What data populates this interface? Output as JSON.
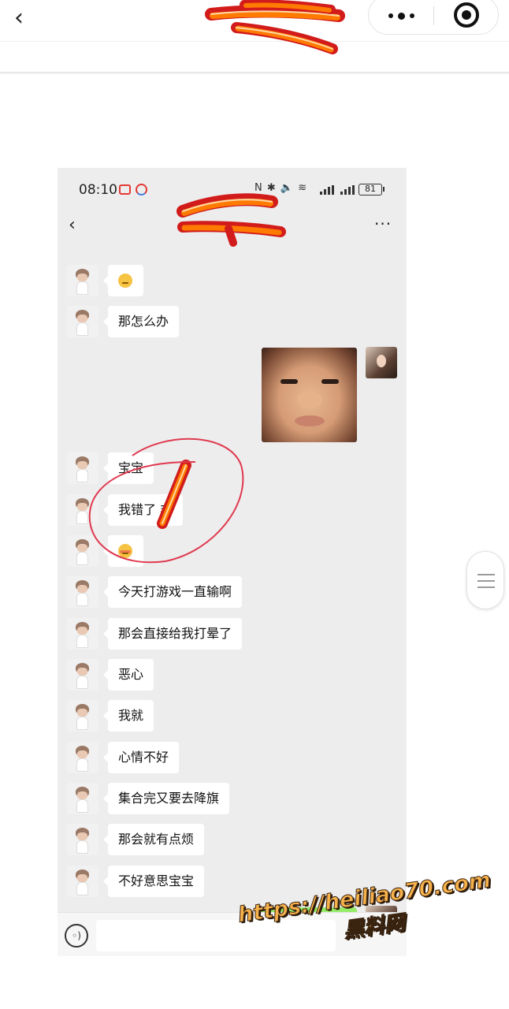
{
  "outer": {
    "back_glyph": "‹",
    "menu_icon": "more-dots-icon",
    "close_icon": "target-icon"
  },
  "phone": {
    "status": {
      "time": "08:10",
      "icons_text": "N ✱ 🔈 ≋",
      "battery": "81"
    },
    "nav": {
      "back_glyph": "‹",
      "more_glyph": "···"
    },
    "messages": [
      {
        "side": "left",
        "type": "emoji",
        "emoji": "frown"
      },
      {
        "side": "left",
        "type": "text",
        "text": "那怎么办"
      },
      {
        "side": "right",
        "type": "image",
        "description_icon": "photo-thumbnail"
      },
      {
        "side": "left",
        "type": "text",
        "text": "宝宝"
      },
      {
        "side": "left",
        "type": "text",
        "text": "我错了 非"
      },
      {
        "side": "left",
        "type": "emoji",
        "emoji": "blush"
      },
      {
        "side": "left",
        "type": "text",
        "text": "今天打游戏一直输啊"
      },
      {
        "side": "left",
        "type": "text",
        "text": "那会直接给我打晕了"
      },
      {
        "side": "left",
        "type": "text",
        "text": "恶心"
      },
      {
        "side": "left",
        "type": "text",
        "text": "我就"
      },
      {
        "side": "left",
        "type": "text",
        "text": "心情不好"
      },
      {
        "side": "left",
        "type": "text",
        "text": "集合完又要去降旗"
      },
      {
        "side": "left",
        "type": "text",
        "text": "那会就有点烦"
      },
      {
        "side": "left",
        "type": "text",
        "text": "不好意思宝宝"
      }
    ],
    "input": {
      "voice_glyph": "◦)"
    }
  },
  "watermark": {
    "url": "https://heiliao70.com",
    "name": "黑料网"
  },
  "colors": {
    "scribble_red": "#d21b1b",
    "scribble_orange": "#ff7a00",
    "scribble_cream": "#ffd9a6",
    "circle": "#e0394f",
    "bubble_green": "#95ec69"
  }
}
